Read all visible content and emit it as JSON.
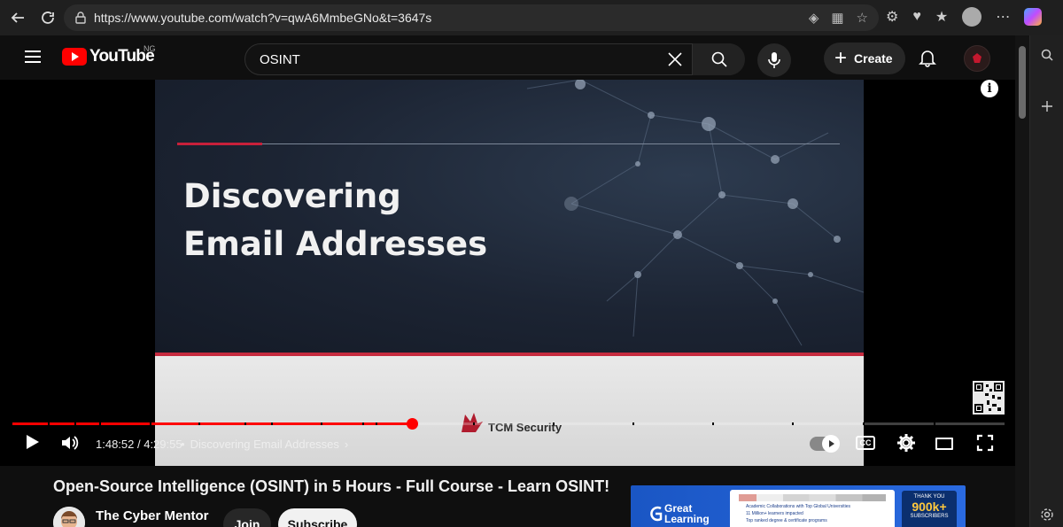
{
  "browser": {
    "url": "https://www.youtube.com/watch?v=qwA6MmbeGNo&t=3647s"
  },
  "masthead": {
    "logo": "YouTube",
    "country_code": "NG",
    "search_value": "OSINT",
    "create_label": "Create"
  },
  "player": {
    "slide_title_line1": "Discovering",
    "slide_title_line2": "Email Addresses",
    "slide_brand": "TCM Security",
    "time_display": "1:48:52 / 4:29:55",
    "chapter_label": "Discovering Email Addresses",
    "progress_fraction": 0.403,
    "cc_label": "CC"
  },
  "video": {
    "title": "Open-Source Intelligence (OSINT) in 5 Hours - Full Course - Learn OSINT!",
    "channel_name": "The Cyber Mentor",
    "join_label": "Join",
    "subscribe_label": "Subscribe"
  },
  "ad": {
    "brand_line1": "Great",
    "brand_line2": "Learning",
    "line1": "Academic Collaborations with Top Global Universities",
    "line2": "11 Million+ learners impacted",
    "line3": "Top ranked degree & certificate programs",
    "badge_top": "THANK YOU",
    "badge_num": "900k+",
    "badge_bottom": "SUBSCRIBERS"
  },
  "colors": {
    "accent": "#ff0000",
    "background": "#0f0f0f"
  }
}
